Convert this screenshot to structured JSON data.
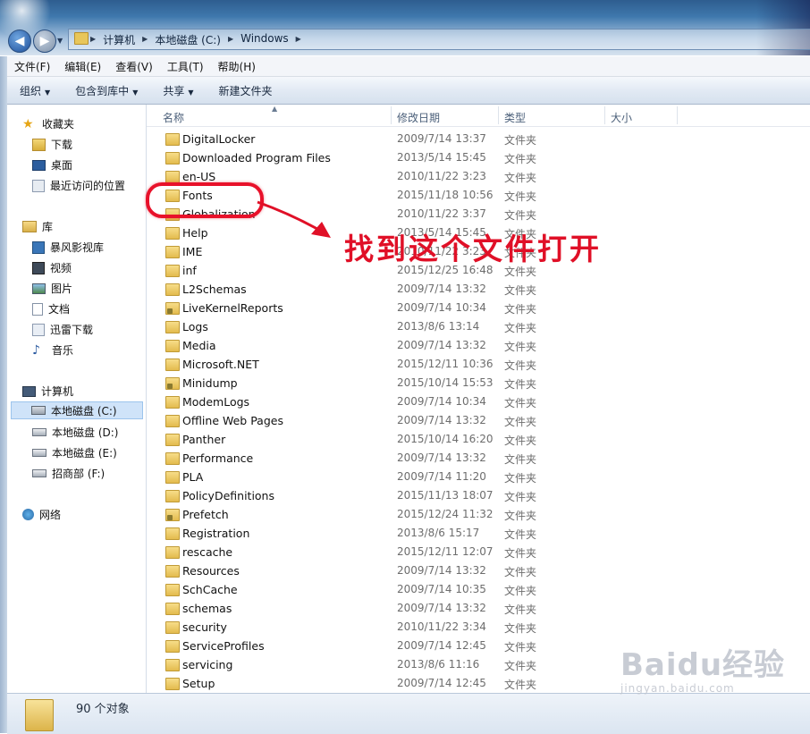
{
  "address": {
    "crumbs": [
      "计算机",
      "本地磁盘 (C:)",
      "Windows"
    ]
  },
  "menu": [
    "文件(F)",
    "编辑(E)",
    "查看(V)",
    "工具(T)",
    "帮助(H)"
  ],
  "toolbar": {
    "organize": "组织",
    "include_library": "包含到库中",
    "share": "共享",
    "new_folder": "新建文件夹"
  },
  "nav": {
    "favorites": "收藏夹",
    "downloads": "下载",
    "desktop": "桌面",
    "recent": "最近访问的位置",
    "libraries": "库",
    "baofeng": "暴风影视库",
    "videos": "视频",
    "pictures": "图片",
    "documents": "文档",
    "xunlei": "迅雷下载",
    "music": "音乐",
    "computer": "计算机",
    "drive_c": "本地磁盘 (C:)",
    "drive_d": "本地磁盘 (D:)",
    "drive_e": "本地磁盘 (E:)",
    "drive_f": "招商部 (F:)",
    "network": "网络"
  },
  "columns": {
    "name": "名称",
    "date": "修改日期",
    "type": "类型",
    "size": "大小"
  },
  "files": [
    {
      "name": "DigitalLocker",
      "date": "2009/7/14 13:37",
      "type": "文件夹"
    },
    {
      "name": "Downloaded Program Files",
      "date": "2013/5/14 15:45",
      "type": "文件夹"
    },
    {
      "name": "en-US",
      "date": "2010/11/22 3:23",
      "type": "文件夹"
    },
    {
      "name": "Fonts",
      "date": "2015/11/18 10:56",
      "type": "文件夹"
    },
    {
      "name": "Globalization",
      "date": "2010/11/22 3:37",
      "type": "文件夹"
    },
    {
      "name": "Help",
      "date": "2013/5/14 15:45",
      "type": "文件夹"
    },
    {
      "name": "IME",
      "date": "2010/11/22 3:23",
      "type": "文件夹"
    },
    {
      "name": "inf",
      "date": "2015/12/25 16:48",
      "type": "文件夹"
    },
    {
      "name": "L2Schemas",
      "date": "2009/7/14 13:32",
      "type": "文件夹"
    },
    {
      "name": "LiveKernelReports",
      "date": "2009/7/14 10:34",
      "type": "文件夹"
    },
    {
      "name": "Logs",
      "date": "2013/8/6 13:14",
      "type": "文件夹"
    },
    {
      "name": "Media",
      "date": "2009/7/14 13:32",
      "type": "文件夹"
    },
    {
      "name": "Microsoft.NET",
      "date": "2015/12/11 10:36",
      "type": "文件夹"
    },
    {
      "name": "Minidump",
      "date": "2015/10/14 15:53",
      "type": "文件夹"
    },
    {
      "name": "ModemLogs",
      "date": "2009/7/14 10:34",
      "type": "文件夹"
    },
    {
      "name": "Offline Web Pages",
      "date": "2009/7/14 13:32",
      "type": "文件夹"
    },
    {
      "name": "Panther",
      "date": "2015/10/14 16:20",
      "type": "文件夹"
    },
    {
      "name": "Performance",
      "date": "2009/7/14 13:32",
      "type": "文件夹"
    },
    {
      "name": "PLA",
      "date": "2009/7/14 11:20",
      "type": "文件夹"
    },
    {
      "name": "PolicyDefinitions",
      "date": "2015/11/13 18:07",
      "type": "文件夹"
    },
    {
      "name": "Prefetch",
      "date": "2015/12/24 11:32",
      "type": "文件夹"
    },
    {
      "name": "Registration",
      "date": "2013/8/6 15:17",
      "type": "文件夹"
    },
    {
      "name": "rescache",
      "date": "2015/12/11 12:07",
      "type": "文件夹"
    },
    {
      "name": "Resources",
      "date": "2009/7/14 13:32",
      "type": "文件夹"
    },
    {
      "name": "SchCache",
      "date": "2009/7/14 10:35",
      "type": "文件夹"
    },
    {
      "name": "schemas",
      "date": "2009/7/14 13:32",
      "type": "文件夹"
    },
    {
      "name": "security",
      "date": "2010/11/22 3:34",
      "type": "文件夹"
    },
    {
      "name": "ServiceProfiles",
      "date": "2009/7/14 12:45",
      "type": "文件夹"
    },
    {
      "name": "servicing",
      "date": "2013/8/6 11:16",
      "type": "文件夹"
    },
    {
      "name": "Setup",
      "date": "2009/7/14 12:45",
      "type": "文件夹"
    }
  ],
  "status": {
    "count": "90 个对象"
  },
  "annotation": "找到这个文件打开",
  "watermark": {
    "brand": "Baidu经验",
    "url": "jingyan.baidu.com"
  },
  "colors": {
    "annotation": "#e01027",
    "selection": "#cfe3f9",
    "folder": "#e3bb4e"
  }
}
